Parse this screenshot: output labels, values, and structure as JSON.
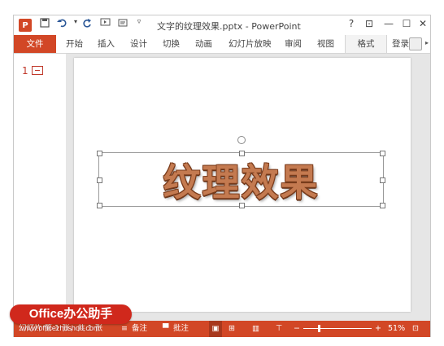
{
  "app": {
    "logo_text": "P",
    "title": "文字的纹理效果.pptx - PowerPoint"
  },
  "quick_access": {
    "save_icon": "save-icon",
    "undo_icon": "undo-icon",
    "redo_icon": "repeat-icon",
    "customize_icon": "customize-icon"
  },
  "window_controls": {
    "help": "?",
    "ribbon_display": "⊡",
    "minimize": "—",
    "maximize": "☐",
    "close": "✕"
  },
  "tabs": {
    "file": "文件",
    "home": "开始",
    "insert": "插入",
    "design": "设计",
    "transitions": "切换",
    "animations": "动画",
    "slideshow": "幻灯片放映",
    "review": "审阅",
    "view": "视图",
    "format": "格式",
    "signin": "登录"
  },
  "thumbnails": {
    "number": "1"
  },
  "slide": {
    "wordart_text": "纹理效果"
  },
  "status": {
    "slide_info": "幻灯片 第 1 张，共 1 张",
    "notes": "备注",
    "comments": "批注",
    "zoom_minus": "−",
    "zoom_plus": "+",
    "zoom_percent": "51%",
    "zoom_level": 0.51
  },
  "watermark": {
    "badge": "Office办公助手",
    "url": "www.officezhushou.com"
  },
  "colors": {
    "accent": "#d24726",
    "wordart_fill": "#c47a50",
    "wordart_outline": "#7a3c1c"
  }
}
